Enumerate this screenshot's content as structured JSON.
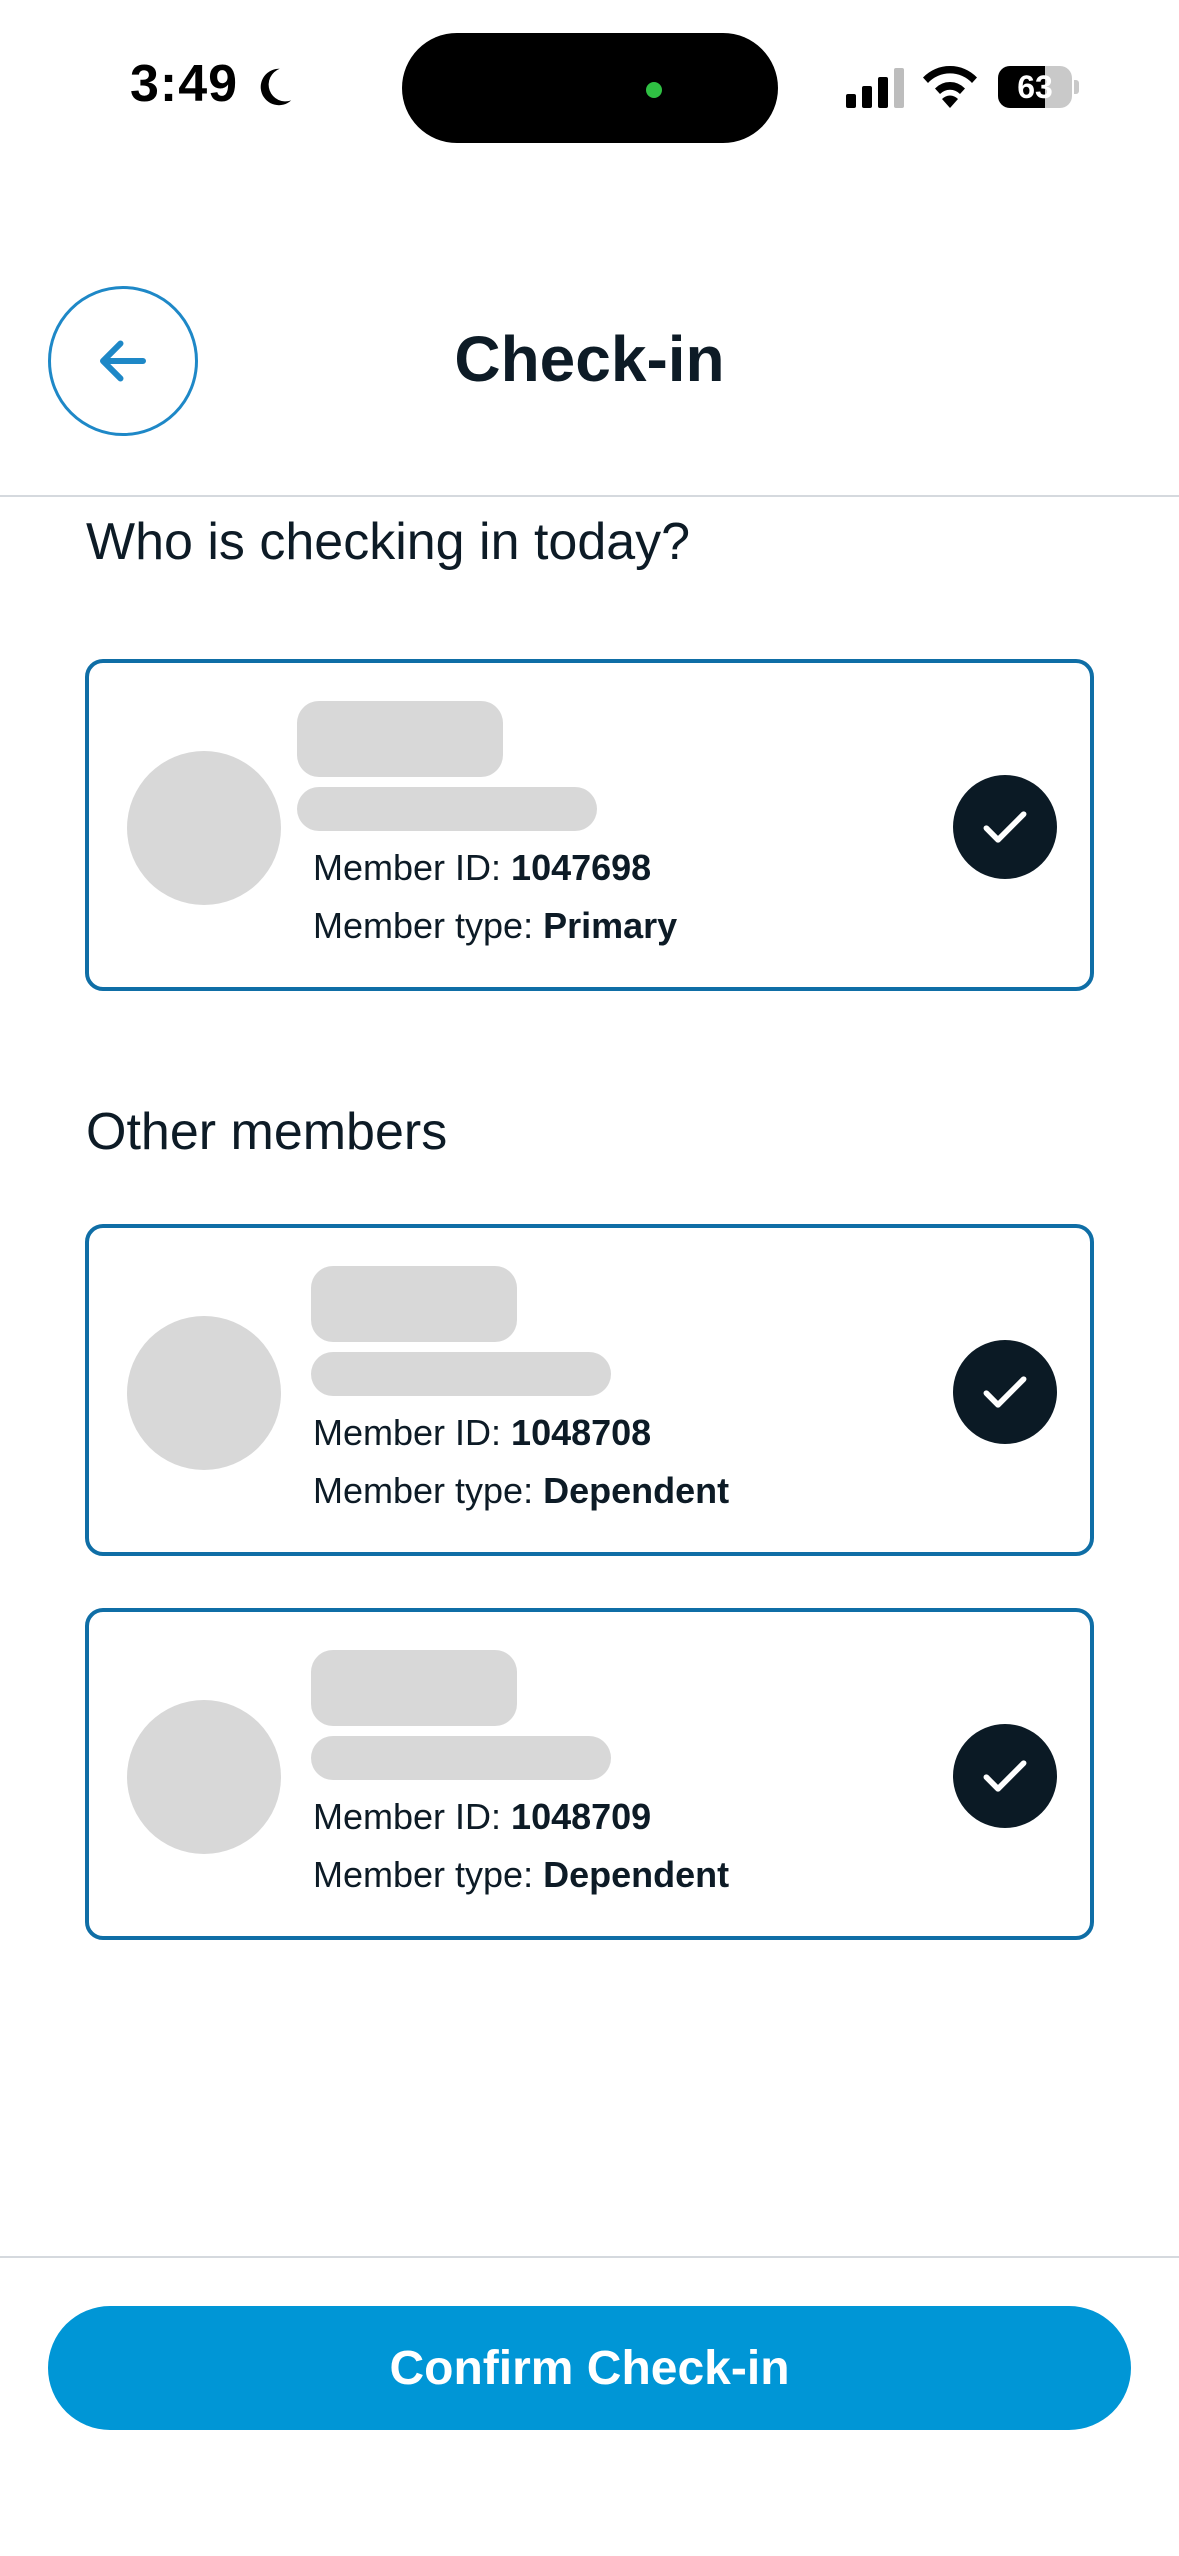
{
  "status_bar": {
    "time": "3:49",
    "battery": "63",
    "battery_level_percent": 63,
    "icons": [
      "moon-icon",
      "signal-icon",
      "wifi-icon",
      "battery-icon"
    ]
  },
  "header": {
    "title": "Check-in",
    "back_icon": "arrow-left-icon"
  },
  "main": {
    "primary_heading": "Who is checking in today?",
    "others_heading": "Other members",
    "members": [
      {
        "id_label": "Member ID: ",
        "id_value": "1047698",
        "type_label": "Member type: ",
        "type_value": "Primary",
        "selected": true
      },
      {
        "id_label": "Member ID: ",
        "id_value": "1048708",
        "type_label": "Member type: ",
        "type_value": "Dependent",
        "selected": true
      },
      {
        "id_label": "Member ID: ",
        "id_value": "1048709",
        "type_label": "Member type: ",
        "type_value": "Dependent",
        "selected": true
      }
    ]
  },
  "footer": {
    "confirm_label": "Confirm Check-in"
  },
  "colors": {
    "accent": "#0096d6",
    "card_border": "#0f6ea6",
    "check_bg": "#0b1a25",
    "placeholder": "#d8d8d8"
  }
}
